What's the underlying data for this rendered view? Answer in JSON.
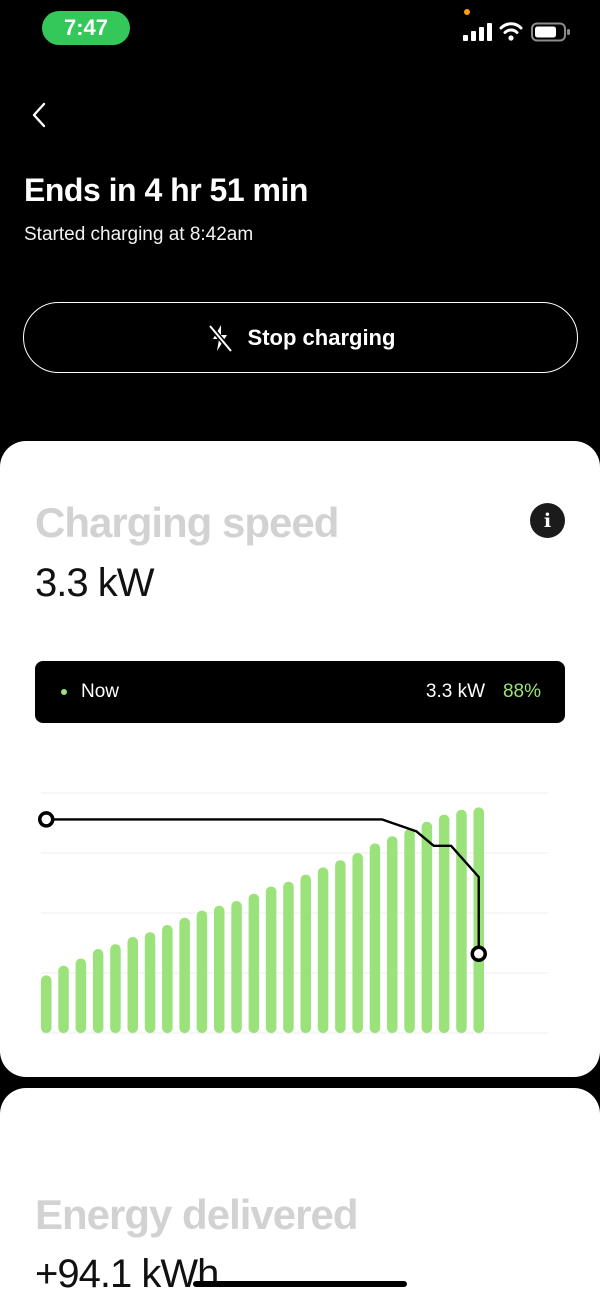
{
  "status_bar": {
    "time": "7:47",
    "time_pill_color": "#34c759",
    "icons": [
      "cellular-signal-icon",
      "wifi-icon",
      "battery-icon"
    ]
  },
  "header": {
    "back_icon": "chevron-left-icon",
    "title": "Ends in 4 hr 51 min",
    "subtitle": "Started charging at 8:42am",
    "stop_button": {
      "label": "Stop charging",
      "icon": "lightning-slash-icon"
    }
  },
  "speed_card": {
    "heading": "Charging speed",
    "value": "3.3 kW",
    "info_icon": "info-icon",
    "info_glyph": "i",
    "now_bar": {
      "label": "Now",
      "power": "3.3 kW",
      "percent": "88%",
      "accent_color": "#9be27a"
    }
  },
  "energy_card": {
    "heading": "Energy delivered",
    "value": "+94.1 kWh"
  },
  "chart_data": {
    "type": "bar",
    "bar_color": "#9be27a",
    "line_color": "#000000",
    "grid": true,
    "ylim": [
      0,
      100
    ],
    "battery_percent_bars": [
      24,
      28,
      31,
      35,
      37,
      40,
      42,
      45,
      48,
      51,
      53,
      55,
      58,
      61,
      63,
      66,
      69,
      72,
      75,
      79,
      82,
      85,
      88,
      91,
      93,
      94
    ],
    "speed_line": {
      "x": [
        0,
        19.4,
        21.4,
        22.4,
        23.4,
        25.0,
        25.0
      ],
      "y": [
        89,
        89,
        84,
        78,
        78,
        65,
        33
      ]
    }
  },
  "home_indicator": true
}
